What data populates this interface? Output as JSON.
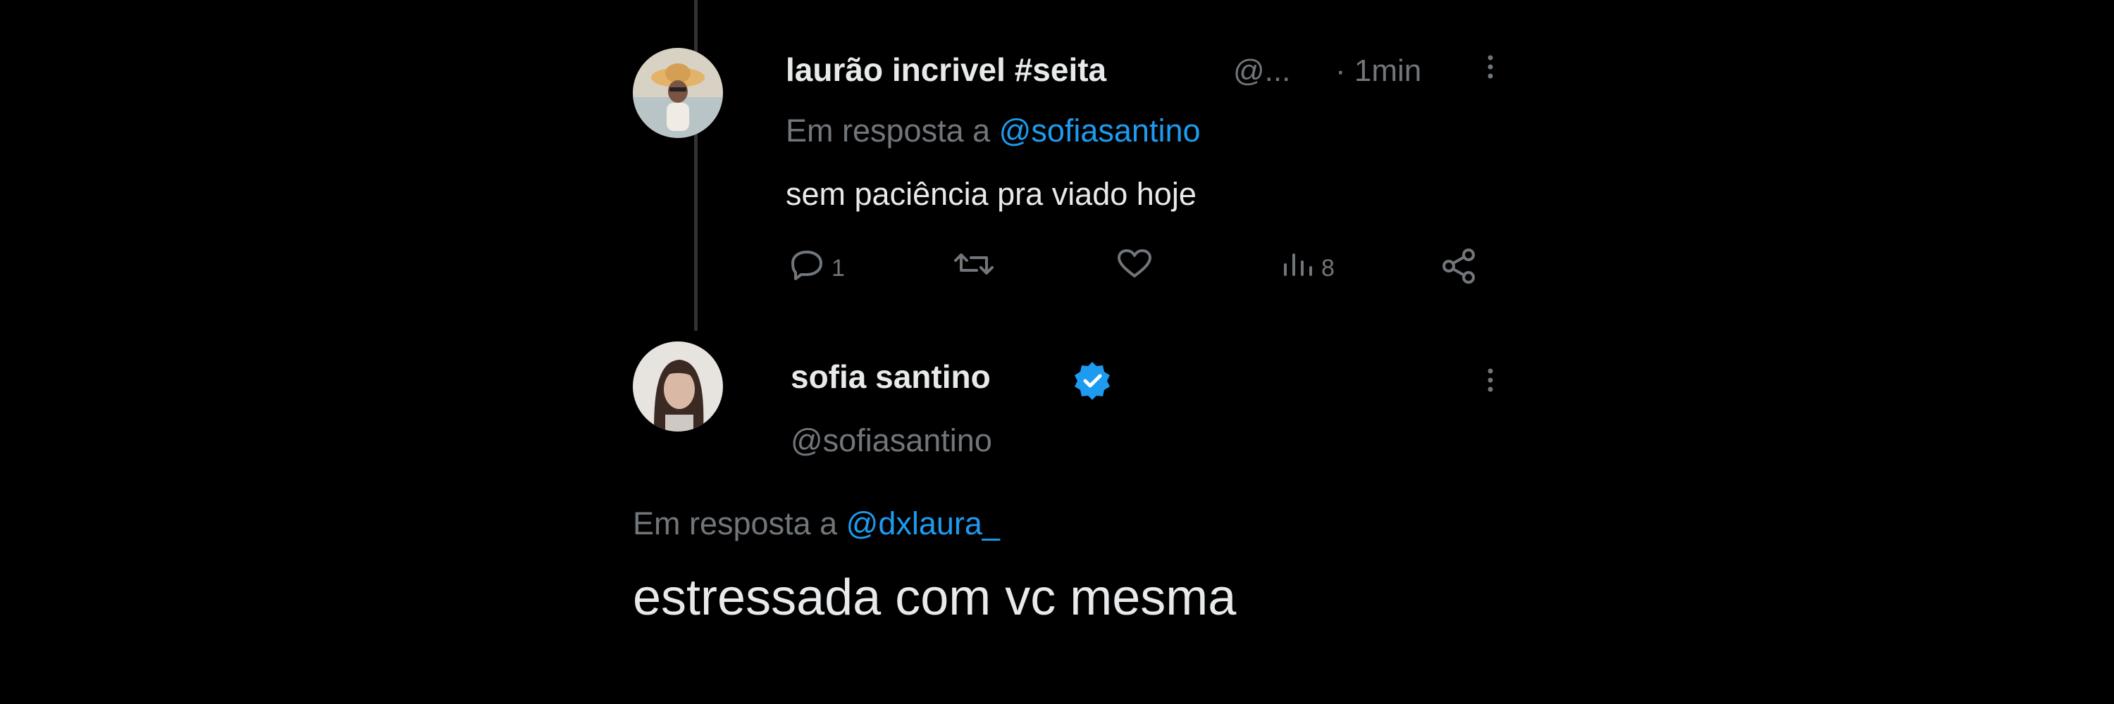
{
  "tweet": {
    "author_name": "laurão incrivel #seita",
    "handle_truncated": "@...",
    "time": "· 1min",
    "reply_prefix": "Em resposta a",
    "reply_to": "@sofiasantino",
    "text": "sem paciência pra viado hoje",
    "reply_count": "1",
    "views_count": "8",
    "icons": [
      "more-icon",
      "reply-icon",
      "retweet-icon",
      "like-icon",
      "views-icon",
      "share-icon"
    ]
  },
  "reply_tweet": {
    "author_name": "sofia santino",
    "handle": "@sofiasantino",
    "reply_prefix": "Em resposta a",
    "reply_to": "@dxlaura_",
    "text": "estressada com vc mesma",
    "verified_color": "#1d9bf0",
    "icons": [
      "verified-badge-icon",
      "more-icon"
    ]
  },
  "colors": {
    "background": "#000000",
    "text": "#e7e9ea",
    "muted": "#71767b",
    "link": "#1d9bf0"
  }
}
